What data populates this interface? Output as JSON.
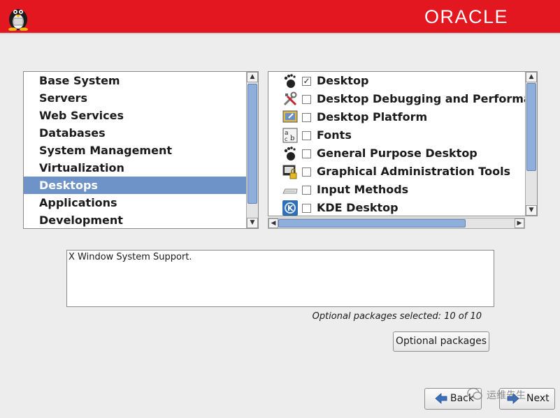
{
  "header": {
    "brand": "ORACLE",
    "bg_color": "#e2171f"
  },
  "categories": {
    "items": [
      {
        "label": "Base System"
      },
      {
        "label": "Servers"
      },
      {
        "label": "Web Services"
      },
      {
        "label": "Databases"
      },
      {
        "label": "System Management"
      },
      {
        "label": "Virtualization"
      },
      {
        "label": "Desktops",
        "selected": true
      },
      {
        "label": "Applications"
      },
      {
        "label": "Development"
      }
    ]
  },
  "packages": {
    "items": [
      {
        "label": "Desktop",
        "checked": true,
        "icon": "gnome-foot-icon"
      },
      {
        "label": "Desktop Debugging and Performa",
        "checked": false,
        "icon": "tools-icon"
      },
      {
        "label": "Desktop Platform",
        "checked": false,
        "icon": "desktop-platform-icon"
      },
      {
        "label": "Fonts",
        "checked": false,
        "icon": "fonts-icon"
      },
      {
        "label": "General Purpose Desktop",
        "checked": false,
        "icon": "gnome-foot-icon"
      },
      {
        "label": "Graphical Administration Tools",
        "checked": false,
        "icon": "admin-lock-icon"
      },
      {
        "label": "Input Methods",
        "checked": false,
        "icon": "keyboard-icon"
      },
      {
        "label": "KDE Desktop",
        "checked": false,
        "icon": "kde-icon"
      }
    ]
  },
  "description": "X Window System Support.",
  "status": "Optional packages selected: 10 of 10",
  "buttons": {
    "optional": "Optional packages",
    "back": "Back",
    "next": "Next"
  },
  "watermark": "运维先生",
  "accent_color": "#6e93c8"
}
